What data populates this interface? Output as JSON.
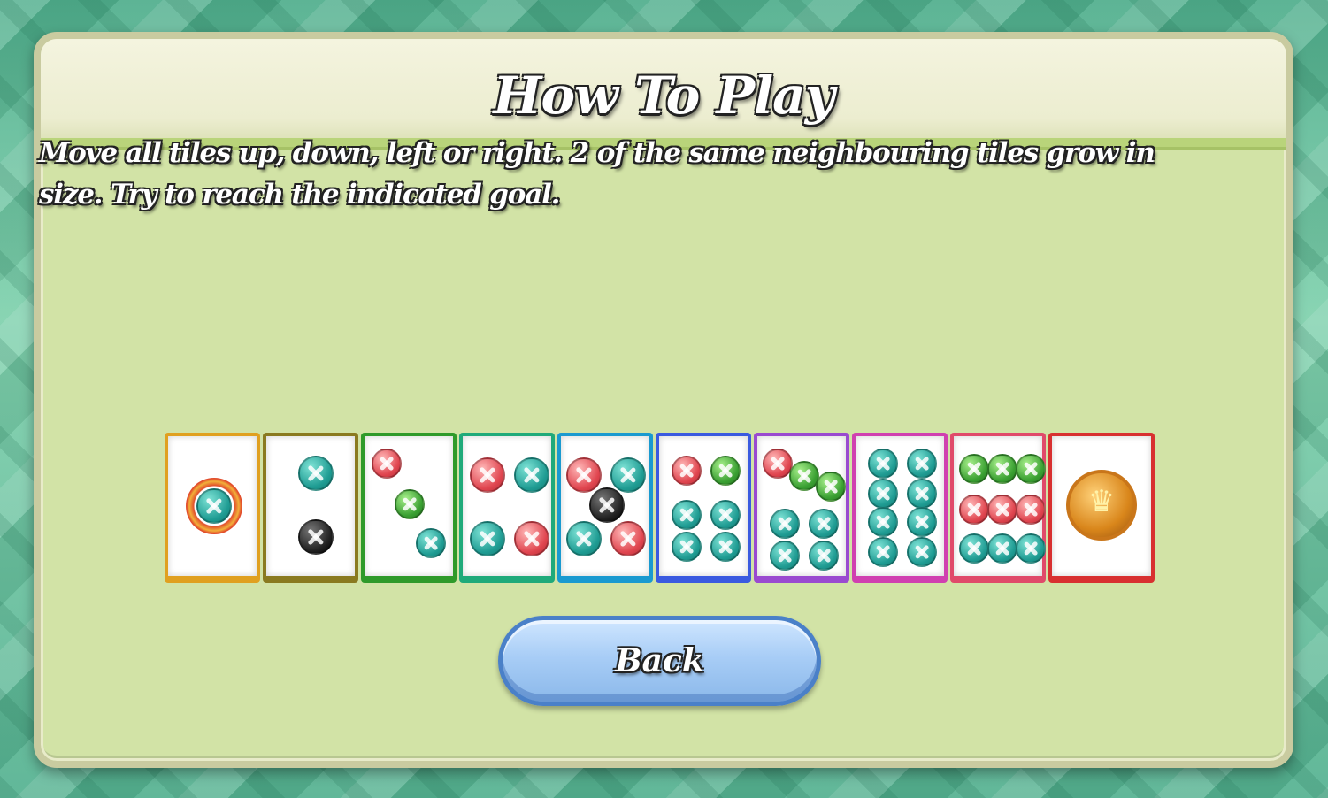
{
  "screen": {
    "title": "How To Play",
    "description": "Move all tiles up, down, left or right. 2 of the same neighbouring tiles grow in size. Try to reach the indicated goal."
  },
  "tiles": [
    {
      "name": "tile-1",
      "border_color": "#e0a020",
      "pips": [],
      "special": "ring"
    },
    {
      "name": "tile-2",
      "border_color": "#8a7a20",
      "pips": [
        [
          "teal",
          false,
          36,
          22
        ],
        [
          "black",
          false,
          36,
          94
        ]
      ]
    },
    {
      "name": "tile-3",
      "border_color": "#2f9a2a",
      "pips": [
        [
          "red",
          true,
          8,
          14
        ],
        [
          "green",
          true,
          34,
          60
        ],
        [
          "teal",
          true,
          58,
          104
        ]
      ]
    },
    {
      "name": "tile-4",
      "border_color": "#1faa7a",
      "pips": [
        [
          "red",
          false,
          8,
          24
        ],
        [
          "teal",
          false,
          58,
          24
        ],
        [
          "teal",
          false,
          8,
          96
        ],
        [
          "red",
          false,
          58,
          96
        ]
      ]
    },
    {
      "name": "tile-5",
      "border_color": "#1a9ad0",
      "pips": [
        [
          "red",
          false,
          6,
          24
        ],
        [
          "teal",
          false,
          56,
          24
        ],
        [
          "black",
          false,
          32,
          58
        ],
        [
          "teal",
          false,
          6,
          96
        ],
        [
          "red",
          false,
          56,
          96
        ]
      ]
    },
    {
      "name": "tile-6",
      "border_color": "#3a5ae0",
      "pips": [
        [
          "red",
          true,
          14,
          22
        ],
        [
          "green",
          true,
          58,
          22
        ],
        [
          "teal",
          true,
          14,
          72
        ],
        [
          "teal",
          true,
          58,
          72
        ],
        [
          "teal",
          true,
          14,
          108
        ],
        [
          "teal",
          true,
          58,
          108
        ]
      ]
    },
    {
      "name": "tile-7",
      "border_color": "#9a4ad0",
      "pips": [
        [
          "red",
          true,
          6,
          14
        ],
        [
          "green",
          true,
          36,
          28
        ],
        [
          "green",
          true,
          66,
          40
        ],
        [
          "teal",
          true,
          14,
          82
        ],
        [
          "teal",
          true,
          58,
          82
        ],
        [
          "teal",
          true,
          14,
          118
        ],
        [
          "teal",
          true,
          58,
          118
        ]
      ]
    },
    {
      "name": "tile-8",
      "border_color": "#d040b0",
      "pips": [
        [
          "teal",
          true,
          14,
          14
        ],
        [
          "teal",
          true,
          58,
          14
        ],
        [
          "teal",
          true,
          14,
          48
        ],
        [
          "teal",
          true,
          58,
          48
        ],
        [
          "teal",
          true,
          14,
          80
        ],
        [
          "teal",
          true,
          58,
          80
        ],
        [
          "teal",
          true,
          14,
          114
        ],
        [
          "teal",
          true,
          58,
          114
        ]
      ]
    },
    {
      "name": "tile-9",
      "border_color": "#e04a6a",
      "pips": [
        [
          "green",
          true,
          6,
          20
        ],
        [
          "green",
          true,
          38,
          20
        ],
        [
          "green",
          true,
          70,
          20
        ],
        [
          "red",
          true,
          6,
          66
        ],
        [
          "red",
          true,
          38,
          66
        ],
        [
          "red",
          true,
          70,
          66
        ],
        [
          "teal",
          true,
          6,
          110
        ],
        [
          "teal",
          true,
          38,
          110
        ],
        [
          "teal",
          true,
          70,
          110
        ]
      ]
    },
    {
      "name": "tile-goal",
      "border_color": "#d83030",
      "pips": [],
      "special": "crown"
    }
  ],
  "buttons": {
    "back_label": "Back"
  },
  "icons": {
    "goal_icon": "crown-medal-icon"
  }
}
